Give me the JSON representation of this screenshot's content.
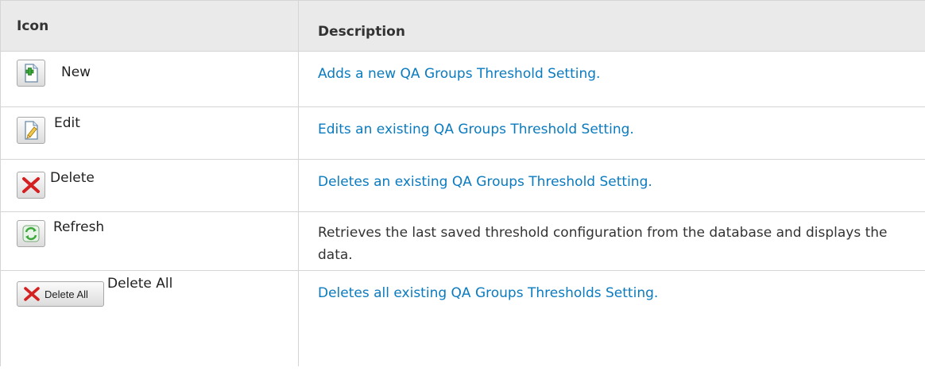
{
  "table": {
    "headers": {
      "icon": "Icon",
      "description": "Description"
    },
    "rows": [
      {
        "label": "New",
        "icon": "new-document-icon",
        "description": "Adds a new QA Groups Threshold Setting.",
        "linked": true
      },
      {
        "label": "Edit",
        "icon": "edit-pencil-icon",
        "description": "Edits an existing QA Groups Threshold Setting.",
        "linked": true
      },
      {
        "label": "Delete",
        "icon": "delete-x-icon",
        "description": "Deletes an existing QA Groups Threshold Setting.",
        "linked": true
      },
      {
        "label": "Refresh",
        "icon": "refresh-icon",
        "description": "Retrieves the last saved threshold configuration from the database and displays the data.",
        "linked": false
      },
      {
        "label": "Delete All",
        "icon": "delete-all-icon",
        "button_text": "Delete All",
        "description": "Deletes all existing QA Groups Thresholds Setting.",
        "linked": true
      }
    ]
  },
  "colors": {
    "link": "#0a7bbf",
    "header_bg": "#eaeaea",
    "border": "#d5d5d5",
    "delete_red": "#d42020",
    "refresh_green": "#3aa83a"
  }
}
